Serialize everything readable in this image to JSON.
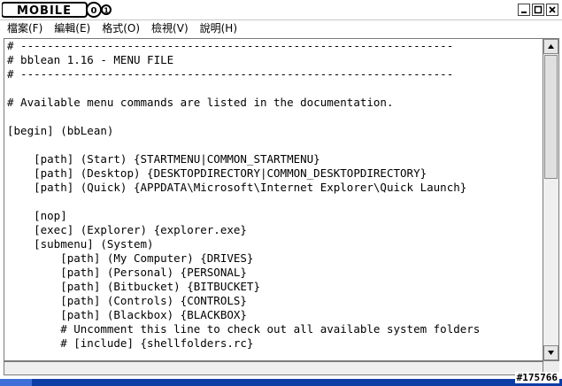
{
  "app": {
    "logo_text": "MOBILE01",
    "watermark": "#175766"
  },
  "menubar": {
    "items": [
      "檔案(F)",
      "編輯(E)",
      "格式(O)",
      "檢視(V)",
      "說明(H)"
    ]
  },
  "editor": {
    "lines": [
      "# -----------------------------------------------------------------",
      "# bblean 1.16 - MENU FILE",
      "# -----------------------------------------------------------------",
      "",
      "# Available menu commands are listed in the documentation.",
      "",
      "[begin] (bbLean)",
      "",
      "    [path] (Start) {STARTMENU|COMMON_STARTMENU}",
      "    [path] (Desktop) {DESKTOPDIRECTORY|COMMON_DESKTOPDIRECTORY}",
      "    [path] (Quick) {APPDATA\\Microsoft\\Internet Explorer\\Quick Launch}",
      "",
      "    [nop]",
      "    [exec] (Explorer) {explorer.exe}",
      "    [submenu] (System)",
      "        [path] (My Computer) {DRIVES}",
      "        [path] (Personal) {PERSONAL}",
      "        [path] (Bitbucket) {BITBUCKET}",
      "        [path] (Controls) {CONTROLS}",
      "        [path] (Blackbox) {BLACKBOX}",
      "        # Uncomment this line to check out all available system folders",
      "        # [include] {shellfolders.rc}"
    ]
  }
}
